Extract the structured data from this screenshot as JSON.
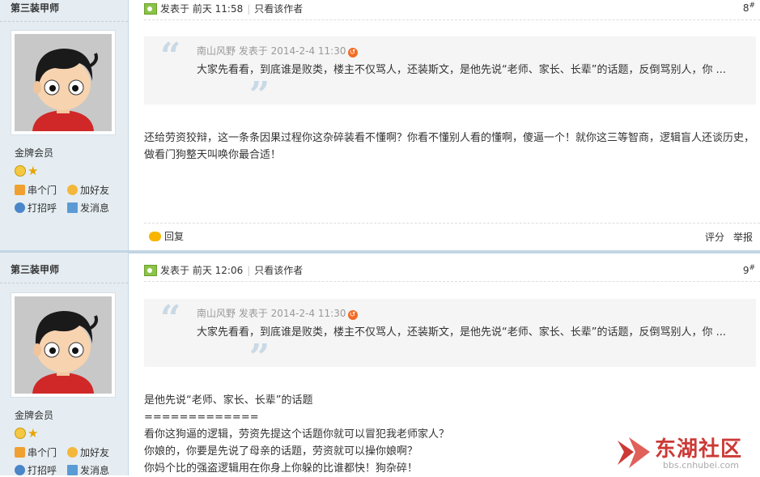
{
  "posts": [
    {
      "author": "第三装甲师",
      "rank": "金牌会员",
      "actions": {
        "visit": "串个门",
        "add_friend": "加好友",
        "greet": "打招呼",
        "message": "发消息"
      },
      "posted": "发表于 前天 11:58",
      "author_only": "只看该作者",
      "floor": "8",
      "floor_sup": "#",
      "quote": {
        "meta": "南山风野 发表于 2014-2-4 11:30",
        "text": "大家先看看，到底谁是败类，楼主不仅骂人，还装斯文，是他先说“老师、家长、长辈”的话题，反倒骂别人，你 ..."
      },
      "body": [
        "还给劳资狡辩，这一条条因果过程你这杂碎装看不懂啊？你看不懂别人看的懂啊，傻逼一个！就你这三等智商，逻辑盲人还谈历史，做看门狗整天叫唤你最合适！"
      ],
      "reply": "回复",
      "rate": "评分",
      "report": "举报"
    },
    {
      "author": "第三装甲师",
      "rank": "金牌会员",
      "actions": {
        "visit": "串个门",
        "add_friend": "加好友",
        "greet": "打招呼",
        "message": "发消息"
      },
      "posted": "发表于 前天 12:06",
      "author_only": "只看该作者",
      "floor": "9",
      "floor_sup": "#",
      "quote": {
        "meta": "南山风野 发表于 2014-2-4 11:30",
        "text": "大家先看看，到底谁是败类，楼主不仅骂人，还装斯文，是他先说“老师、家长、长辈”的话题，反倒骂别人，你 ..."
      },
      "body": [
        "是他先说“老师、家长、长辈”的话题",
        "=============",
        "看你这狗逼的逻辑，劳资先提这个话题你就可以冒犯我老师家人？",
        "你娘的，你要是先说了母亲的话题，劳资就可以操你娘啊？",
        "你妈个比的强盗逻辑用在你身上你躲的比谁都快！狗杂碎！"
      ]
    }
  ],
  "watermark": {
    "name": "东湖社区",
    "url": "bbs.cnhubei.com"
  }
}
